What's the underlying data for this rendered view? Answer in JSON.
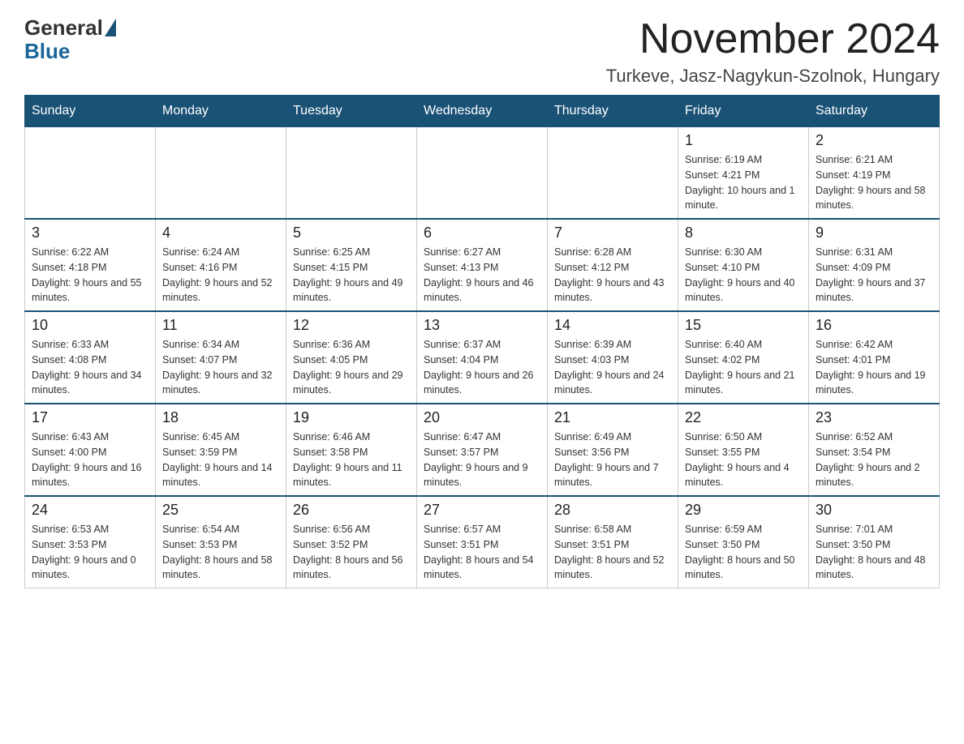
{
  "header": {
    "logo_general": "General",
    "logo_blue": "Blue",
    "month_title": "November 2024",
    "location": "Turkeve, Jasz-Nagykun-Szolnok, Hungary"
  },
  "weekdays": [
    "Sunday",
    "Monday",
    "Tuesday",
    "Wednesday",
    "Thursday",
    "Friday",
    "Saturday"
  ],
  "weeks": [
    [
      {
        "day": "",
        "info": ""
      },
      {
        "day": "",
        "info": ""
      },
      {
        "day": "",
        "info": ""
      },
      {
        "day": "",
        "info": ""
      },
      {
        "day": "",
        "info": ""
      },
      {
        "day": "1",
        "info": "Sunrise: 6:19 AM\nSunset: 4:21 PM\nDaylight: 10 hours and 1 minute."
      },
      {
        "day": "2",
        "info": "Sunrise: 6:21 AM\nSunset: 4:19 PM\nDaylight: 9 hours and 58 minutes."
      }
    ],
    [
      {
        "day": "3",
        "info": "Sunrise: 6:22 AM\nSunset: 4:18 PM\nDaylight: 9 hours and 55 minutes."
      },
      {
        "day": "4",
        "info": "Sunrise: 6:24 AM\nSunset: 4:16 PM\nDaylight: 9 hours and 52 minutes."
      },
      {
        "day": "5",
        "info": "Sunrise: 6:25 AM\nSunset: 4:15 PM\nDaylight: 9 hours and 49 minutes."
      },
      {
        "day": "6",
        "info": "Sunrise: 6:27 AM\nSunset: 4:13 PM\nDaylight: 9 hours and 46 minutes."
      },
      {
        "day": "7",
        "info": "Sunrise: 6:28 AM\nSunset: 4:12 PM\nDaylight: 9 hours and 43 minutes."
      },
      {
        "day": "8",
        "info": "Sunrise: 6:30 AM\nSunset: 4:10 PM\nDaylight: 9 hours and 40 minutes."
      },
      {
        "day": "9",
        "info": "Sunrise: 6:31 AM\nSunset: 4:09 PM\nDaylight: 9 hours and 37 minutes."
      }
    ],
    [
      {
        "day": "10",
        "info": "Sunrise: 6:33 AM\nSunset: 4:08 PM\nDaylight: 9 hours and 34 minutes."
      },
      {
        "day": "11",
        "info": "Sunrise: 6:34 AM\nSunset: 4:07 PM\nDaylight: 9 hours and 32 minutes."
      },
      {
        "day": "12",
        "info": "Sunrise: 6:36 AM\nSunset: 4:05 PM\nDaylight: 9 hours and 29 minutes."
      },
      {
        "day": "13",
        "info": "Sunrise: 6:37 AM\nSunset: 4:04 PM\nDaylight: 9 hours and 26 minutes."
      },
      {
        "day": "14",
        "info": "Sunrise: 6:39 AM\nSunset: 4:03 PM\nDaylight: 9 hours and 24 minutes."
      },
      {
        "day": "15",
        "info": "Sunrise: 6:40 AM\nSunset: 4:02 PM\nDaylight: 9 hours and 21 minutes."
      },
      {
        "day": "16",
        "info": "Sunrise: 6:42 AM\nSunset: 4:01 PM\nDaylight: 9 hours and 19 minutes."
      }
    ],
    [
      {
        "day": "17",
        "info": "Sunrise: 6:43 AM\nSunset: 4:00 PM\nDaylight: 9 hours and 16 minutes."
      },
      {
        "day": "18",
        "info": "Sunrise: 6:45 AM\nSunset: 3:59 PM\nDaylight: 9 hours and 14 minutes."
      },
      {
        "day": "19",
        "info": "Sunrise: 6:46 AM\nSunset: 3:58 PM\nDaylight: 9 hours and 11 minutes."
      },
      {
        "day": "20",
        "info": "Sunrise: 6:47 AM\nSunset: 3:57 PM\nDaylight: 9 hours and 9 minutes."
      },
      {
        "day": "21",
        "info": "Sunrise: 6:49 AM\nSunset: 3:56 PM\nDaylight: 9 hours and 7 minutes."
      },
      {
        "day": "22",
        "info": "Sunrise: 6:50 AM\nSunset: 3:55 PM\nDaylight: 9 hours and 4 minutes."
      },
      {
        "day": "23",
        "info": "Sunrise: 6:52 AM\nSunset: 3:54 PM\nDaylight: 9 hours and 2 minutes."
      }
    ],
    [
      {
        "day": "24",
        "info": "Sunrise: 6:53 AM\nSunset: 3:53 PM\nDaylight: 9 hours and 0 minutes."
      },
      {
        "day": "25",
        "info": "Sunrise: 6:54 AM\nSunset: 3:53 PM\nDaylight: 8 hours and 58 minutes."
      },
      {
        "day": "26",
        "info": "Sunrise: 6:56 AM\nSunset: 3:52 PM\nDaylight: 8 hours and 56 minutes."
      },
      {
        "day": "27",
        "info": "Sunrise: 6:57 AM\nSunset: 3:51 PM\nDaylight: 8 hours and 54 minutes."
      },
      {
        "day": "28",
        "info": "Sunrise: 6:58 AM\nSunset: 3:51 PM\nDaylight: 8 hours and 52 minutes."
      },
      {
        "day": "29",
        "info": "Sunrise: 6:59 AM\nSunset: 3:50 PM\nDaylight: 8 hours and 50 minutes."
      },
      {
        "day": "30",
        "info": "Sunrise: 7:01 AM\nSunset: 3:50 PM\nDaylight: 8 hours and 48 minutes."
      }
    ]
  ]
}
